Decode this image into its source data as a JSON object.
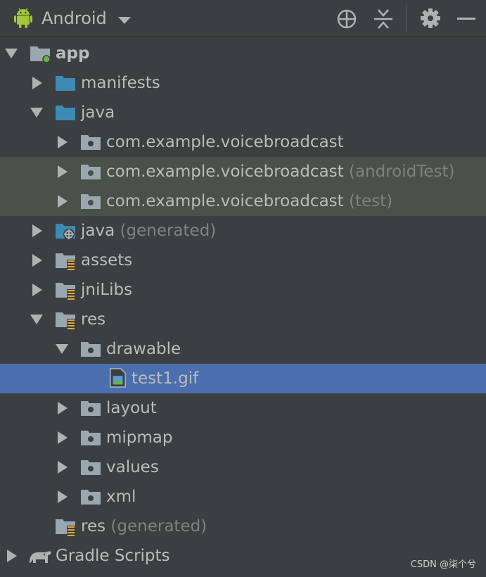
{
  "toolbar": {
    "view_title": "Android",
    "icons": [
      "android-icon",
      "chevron-down-icon",
      "locate-icon",
      "collapse-all-icon",
      "gear-icon",
      "minimize-icon"
    ]
  },
  "tree": {
    "rows": [
      {
        "label": "app",
        "suffix": ""
      },
      {
        "label": "manifests",
        "suffix": ""
      },
      {
        "label": "java",
        "suffix": ""
      },
      {
        "label": "com.example.voicebroadcast",
        "suffix": ""
      },
      {
        "label": "com.example.voicebroadcast",
        "suffix": "(androidTest)"
      },
      {
        "label": "com.example.voicebroadcast",
        "suffix": "(test)"
      },
      {
        "label": "java",
        "suffix": "(generated)"
      },
      {
        "label": "assets",
        "suffix": ""
      },
      {
        "label": "jniLibs",
        "suffix": ""
      },
      {
        "label": "res",
        "suffix": ""
      },
      {
        "label": "drawable",
        "suffix": ""
      },
      {
        "label": "test1.gif",
        "suffix": ""
      },
      {
        "label": "layout",
        "suffix": ""
      },
      {
        "label": "mipmap",
        "suffix": ""
      },
      {
        "label": "values",
        "suffix": ""
      },
      {
        "label": "xml",
        "suffix": ""
      },
      {
        "label": "res",
        "suffix": "(generated)"
      },
      {
        "label": "Gradle Scripts",
        "suffix": ""
      }
    ]
  },
  "watermark": "CSDN @柒个兮",
  "colors": {
    "background": "#3c3f41",
    "selection": "#4b6eaf",
    "test_source_row": "#4a5148",
    "folder_blue": "#3d8bb5",
    "folder_gray": "#9aa7b0",
    "android_green": "#a4c639"
  }
}
